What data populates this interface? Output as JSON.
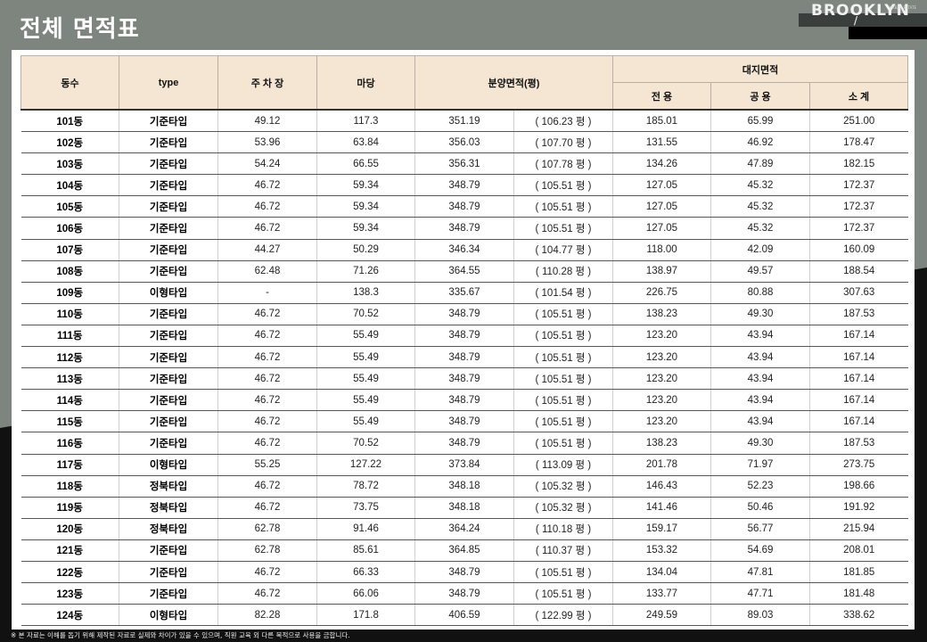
{
  "page": {
    "title": "전체 면적표",
    "logo": {
      "text": "BROOKLYN",
      "subtext": "URBAN ESTATE",
      "mark": "/"
    },
    "footnote": "※ 본 자료는 이해를 돕기 위해 제작된 자료로 실제와 차이가 있을 수 있으며, 직원 교육 외 다른 목적으로 사용을 금합니다."
  },
  "table": {
    "headers": {
      "dong": "동수",
      "type": "type",
      "parking": "주 차 장",
      "yard": "마당",
      "sale_area": "분양면적(평)",
      "land_area": "대지면적",
      "exclusive": "전 용",
      "common": "공 용",
      "subtotal": "소 계"
    },
    "rows": [
      {
        "dong": "101동",
        "type": "기준타입",
        "parking": "49.12",
        "yard": "117.3",
        "sale": "351.19",
        "pyeong": "( 106.23 평 )",
        "exclusive": "185.01",
        "common": "65.99",
        "subtotal": "251.00"
      },
      {
        "dong": "102동",
        "type": "기준타입",
        "parking": "53.96",
        "yard": "63.84",
        "sale": "356.03",
        "pyeong": "( 107.70 평 )",
        "exclusive": "131.55",
        "common": "46.92",
        "subtotal": "178.47"
      },
      {
        "dong": "103동",
        "type": "기준타입",
        "parking": "54.24",
        "yard": "66.55",
        "sale": "356.31",
        "pyeong": "( 107.78 평 )",
        "exclusive": "134.26",
        "common": "47.89",
        "subtotal": "182.15"
      },
      {
        "dong": "104동",
        "type": "기준타입",
        "parking": "46.72",
        "yard": "59.34",
        "sale": "348.79",
        "pyeong": "( 105.51 평 )",
        "exclusive": "127.05",
        "common": "45.32",
        "subtotal": "172.37"
      },
      {
        "dong": "105동",
        "type": "기준타입",
        "parking": "46.72",
        "yard": "59.34",
        "sale": "348.79",
        "pyeong": "( 105.51 평 )",
        "exclusive": "127.05",
        "common": "45.32",
        "subtotal": "172.37"
      },
      {
        "dong": "106동",
        "type": "기준타입",
        "parking": "46.72",
        "yard": "59.34",
        "sale": "348.79",
        "pyeong": "( 105.51 평 )",
        "exclusive": "127.05",
        "common": "45.32",
        "subtotal": "172.37"
      },
      {
        "dong": "107동",
        "type": "기준타입",
        "parking": "44.27",
        "yard": "50.29",
        "sale": "346.34",
        "pyeong": "( 104.77 평 )",
        "exclusive": "118.00",
        "common": "42.09",
        "subtotal": "160.09"
      },
      {
        "dong": "108동",
        "type": "기준타입",
        "parking": "62.48",
        "yard": "71.26",
        "sale": "364.55",
        "pyeong": "( 110.28 평 )",
        "exclusive": "138.97",
        "common": "49.57",
        "subtotal": "188.54"
      },
      {
        "dong": "109동",
        "type": "이형타입",
        "parking": "-",
        "yard": "138.3",
        "sale": "335.67",
        "pyeong": "( 101.54 평 )",
        "exclusive": "226.75",
        "common": "80.88",
        "subtotal": "307.63"
      },
      {
        "dong": "110동",
        "type": "기준타입",
        "parking": "46.72",
        "yard": "70.52",
        "sale": "348.79",
        "pyeong": "( 105.51 평 )",
        "exclusive": "138.23",
        "common": "49.30",
        "subtotal": "187.53"
      },
      {
        "dong": "111동",
        "type": "기준타입",
        "parking": "46.72",
        "yard": "55.49",
        "sale": "348.79",
        "pyeong": "( 105.51 평 )",
        "exclusive": "123.20",
        "common": "43.94",
        "subtotal": "167.14"
      },
      {
        "dong": "112동",
        "type": "기준타입",
        "parking": "46.72",
        "yard": "55.49",
        "sale": "348.79",
        "pyeong": "( 105.51 평 )",
        "exclusive": "123.20",
        "common": "43.94",
        "subtotal": "167.14"
      },
      {
        "dong": "113동",
        "type": "기준타입",
        "parking": "46.72",
        "yard": "55.49",
        "sale": "348.79",
        "pyeong": "( 105.51 평 )",
        "exclusive": "123.20",
        "common": "43.94",
        "subtotal": "167.14"
      },
      {
        "dong": "114동",
        "type": "기준타입",
        "parking": "46.72",
        "yard": "55.49",
        "sale": "348.79",
        "pyeong": "( 105.51 평 )",
        "exclusive": "123.20",
        "common": "43.94",
        "subtotal": "167.14"
      },
      {
        "dong": "115동",
        "type": "기준타입",
        "parking": "46.72",
        "yard": "55.49",
        "sale": "348.79",
        "pyeong": "( 105.51 평 )",
        "exclusive": "123.20",
        "common": "43.94",
        "subtotal": "167.14"
      },
      {
        "dong": "116동",
        "type": "기준타입",
        "parking": "46.72",
        "yard": "70.52",
        "sale": "348.79",
        "pyeong": "( 105.51 평 )",
        "exclusive": "138.23",
        "common": "49.30",
        "subtotal": "187.53"
      },
      {
        "dong": "117동",
        "type": "이형타입",
        "parking": "55.25",
        "yard": "127.22",
        "sale": "373.84",
        "pyeong": "( 113.09 평 )",
        "exclusive": "201.78",
        "common": "71.97",
        "subtotal": "273.75"
      },
      {
        "dong": "118동",
        "type": "정북타입",
        "parking": "46.72",
        "yard": "78.72",
        "sale": "348.18",
        "pyeong": "( 105.32 평 )",
        "exclusive": "146.43",
        "common": "52.23",
        "subtotal": "198.66"
      },
      {
        "dong": "119동",
        "type": "정북타입",
        "parking": "46.72",
        "yard": "73.75",
        "sale": "348.18",
        "pyeong": "( 105.32 평 )",
        "exclusive": "141.46",
        "common": "50.46",
        "subtotal": "191.92"
      },
      {
        "dong": "120동",
        "type": "정북타입",
        "parking": "62.78",
        "yard": "91.46",
        "sale": "364.24",
        "pyeong": "( 110.18 평 )",
        "exclusive": "159.17",
        "common": "56.77",
        "subtotal": "215.94"
      },
      {
        "dong": "121동",
        "type": "기준타입",
        "parking": "62.78",
        "yard": "85.61",
        "sale": "364.85",
        "pyeong": "( 110.37 평 )",
        "exclusive": "153.32",
        "common": "54.69",
        "subtotal": "208.01"
      },
      {
        "dong": "122동",
        "type": "기준타입",
        "parking": "46.72",
        "yard": "66.33",
        "sale": "348.79",
        "pyeong": "( 105.51 평 )",
        "exclusive": "134.04",
        "common": "47.81",
        "subtotal": "181.85"
      },
      {
        "dong": "123동",
        "type": "기준타입",
        "parking": "46.72",
        "yard": "66.06",
        "sale": "348.79",
        "pyeong": "( 105.51 평 )",
        "exclusive": "133.77",
        "common": "47.71",
        "subtotal": "181.48"
      },
      {
        "dong": "124동",
        "type": "이형타입",
        "parking": "82.28",
        "yard": "171.8",
        "sale": "406.59",
        "pyeong": "( 122.99 평 )",
        "exclusive": "249.59",
        "common": "89.03",
        "subtotal": "338.62"
      }
    ]
  }
}
